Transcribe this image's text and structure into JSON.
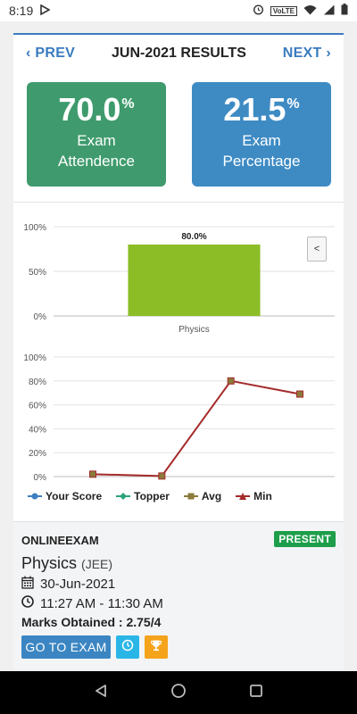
{
  "status_bar": {
    "time": "8:19",
    "network_label": "VoLTE"
  },
  "header": {
    "prev_label": "PREV",
    "title": "JUN-2021 RESULTS",
    "next_label": "NEXT"
  },
  "stats": {
    "attendance": {
      "value": "70.0",
      "unit": "%",
      "label_line1": "Exam",
      "label_line2": "Attendence",
      "color": "#3f9b6d"
    },
    "percentage": {
      "value": "21.5",
      "unit": "%",
      "label_line1": "Exam",
      "label_line2": "Percentage",
      "color": "#3e8bc4"
    }
  },
  "chart_data": [
    {
      "type": "bar",
      "categories": [
        "Physics"
      ],
      "values": [
        80.0
      ],
      "data_labels": [
        "80.0%"
      ],
      "ylim": [
        0,
        100
      ],
      "yticks": [
        "0%",
        "50%",
        "100%"
      ],
      "bar_color": "#8cbd26",
      "grid": true
    },
    {
      "type": "line",
      "x": [
        1,
        2,
        3,
        4
      ],
      "ylim": [
        0,
        100
      ],
      "yticks": [
        "0%",
        "20%",
        "40%",
        "60%",
        "80%",
        "100%"
      ],
      "series": [
        {
          "name": "Min",
          "values": [
            2,
            0.5,
            80,
            69
          ],
          "color": "#a52a2a"
        }
      ],
      "legend": [
        {
          "name": "Your Score",
          "color": "#3d7fc1",
          "marker": "circle"
        },
        {
          "name": "Topper",
          "color": "#2aa37a",
          "marker": "diamond"
        },
        {
          "name": "Avg",
          "color": "#8b7a3a",
          "marker": "square"
        },
        {
          "name": "Min",
          "color": "#a52a2a",
          "marker": "triangle"
        }
      ],
      "legend_position": "bottom",
      "grid": true
    }
  ],
  "chart_controls": {
    "collapse_label": "<"
  },
  "exam": {
    "type": "ONLINEEXAM",
    "status": "PRESENT",
    "subject": "Physics",
    "subject_tag": "(JEE)",
    "date": "30-Jun-2021",
    "time_range": "11:27 AM - 11:30 AM",
    "marks": "Marks Obtained : 2.75/4",
    "go_button": "GO TO EXAM"
  }
}
